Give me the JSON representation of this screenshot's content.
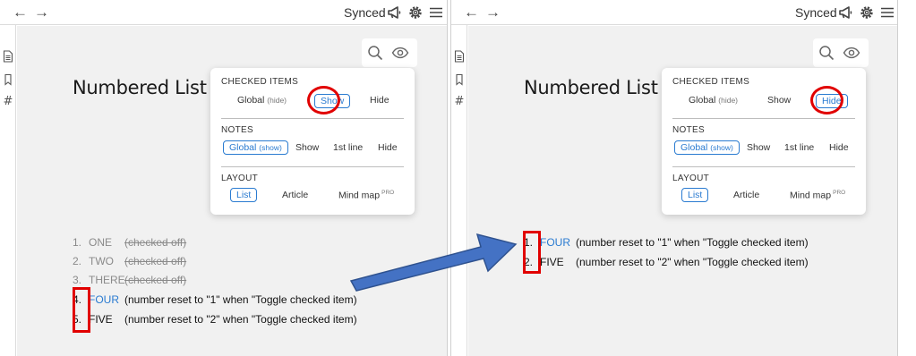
{
  "panels": [
    {
      "topbar": {
        "back_icon": "arrow-left-icon",
        "forward_icon": "arrow-right-icon",
        "back_glyph": "←",
        "forward_glyph": "→",
        "status": "Synced"
      },
      "sidebar": {
        "hash_glyph": "#"
      },
      "page_title": "Numbered List",
      "popup": {
        "checked_items": {
          "title": "CHECKED ITEMS",
          "global": "Global",
          "global_hint": "(hide)",
          "show": "Show",
          "hide": "Hide",
          "selected": "show"
        },
        "notes": {
          "title": "NOTES",
          "global": "Global",
          "global_hint": "(show)",
          "show": "Show",
          "first_line": "1st line",
          "hide": "Hide",
          "selected": "global"
        },
        "layout": {
          "title": "LAYOUT",
          "list": "List",
          "article": "Article",
          "mind_map": "Mind map",
          "pro": "PRO",
          "selected": "list"
        }
      },
      "items": [
        {
          "num": "1.",
          "text": "ONE",
          "note": "(checked off)",
          "checked": true
        },
        {
          "num": "2.",
          "text": "TWO",
          "note": "(checked off)",
          "checked": true
        },
        {
          "num": "3.",
          "text": "THERE",
          "note": "(checked off)",
          "checked": true
        },
        {
          "num": "4.",
          "text": "FOUR",
          "note": "(number reset to \"1\" when \"Toggle checked item)",
          "checked": false
        },
        {
          "num": "5.",
          "text": "FIVE",
          "note": "(number reset to \"2\" when \"Toggle checked item)",
          "checked": false
        }
      ]
    },
    {
      "topbar": {
        "back_icon": "arrow-left-icon",
        "forward_icon": "arrow-right-icon",
        "back_glyph": "←",
        "forward_glyph": "→",
        "status": "Synced"
      },
      "sidebar": {
        "hash_glyph": "#"
      },
      "page_title": "Numbered List",
      "popup": {
        "checked_items": {
          "title": "CHECKED ITEMS",
          "global": "Global",
          "global_hint": "(hide)",
          "show": "Show",
          "hide": "Hide",
          "selected": "hide"
        },
        "notes": {
          "title": "NOTES",
          "global": "Global",
          "global_hint": "(show)",
          "show": "Show",
          "first_line": "1st line",
          "hide": "Hide",
          "selected": "global"
        },
        "layout": {
          "title": "LAYOUT",
          "list": "List",
          "article": "Article",
          "mind_map": "Mind map",
          "pro": "PRO",
          "selected": "list"
        }
      },
      "items": [
        {
          "num": "1.",
          "text": "FOUR",
          "note": "(number reset to \"1\" when \"Toggle checked item)",
          "checked": false
        },
        {
          "num": "2.",
          "text": "FIVE",
          "note": "(number reset to \"2\" when \"Toggle checked item)",
          "checked": false
        }
      ]
    }
  ],
  "colors": {
    "accent": "#2a7bd1",
    "highlight_red": "#e10000",
    "arrow_blue": "#4472c4",
    "background": "#f1f1f1"
  }
}
